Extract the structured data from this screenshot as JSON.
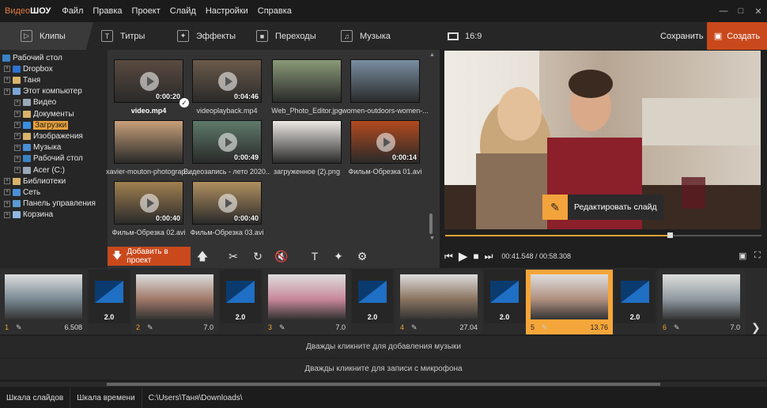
{
  "app": {
    "logo_part1": "Видео",
    "logo_part2": "ШОУ",
    "menu": [
      "Файл",
      "Правка",
      "Проект",
      "Слайд",
      "Настройки",
      "Справка"
    ]
  },
  "tabs": [
    "Клипы",
    "Титры",
    "Эффекты",
    "Переходы",
    "Музыка"
  ],
  "header": {
    "ratio": "16:9",
    "save": "Сохранить",
    "create": "Создать"
  },
  "tree": [
    {
      "label": "Рабочий стол",
      "level": 0
    },
    {
      "label": "Dropbox",
      "level": 1
    },
    {
      "label": "Таня",
      "level": 1
    },
    {
      "label": "Этот компьютер",
      "level": 1
    },
    {
      "label": "Видео",
      "level": 2
    },
    {
      "label": "Документы",
      "level": 2
    },
    {
      "label": "Загрузки",
      "level": 2,
      "selected": true
    },
    {
      "label": "Изображения",
      "level": 2
    },
    {
      "label": "Музыка",
      "level": 2
    },
    {
      "label": "Рабочий стол",
      "level": 2
    },
    {
      "label": "Acer (C:)",
      "level": 2
    },
    {
      "label": "Библиотеки",
      "level": 1
    },
    {
      "label": "Сеть",
      "level": 1
    },
    {
      "label": "Панель управления",
      "level": 1
    },
    {
      "label": "Корзина",
      "level": 1
    }
  ],
  "files": [
    {
      "name": "video.mp4",
      "duration": "0:00:20",
      "checked": true,
      "bold": true
    },
    {
      "name": "videoplayback.mp4",
      "duration": "0:04:46"
    },
    {
      "name": "Web_Photo_Editor.jpg",
      "duration": ""
    },
    {
      "name": "women-outdoors-women-...",
      "duration": ""
    },
    {
      "name": "xavier-mouton-photograp...",
      "duration": ""
    },
    {
      "name": "Видеозапись - лето 2020...",
      "duration": "0:00:49"
    },
    {
      "name": "загруженное (2).png",
      "duration": ""
    },
    {
      "name": "Фильм-Обрезка 01.avi",
      "duration": "0:00:14"
    },
    {
      "name": "Фильм-Обрезка 02.avi",
      "duration": "0:00:40"
    },
    {
      "name": "Фильм-Обрезка 03.avi",
      "duration": "0:00:40"
    }
  ],
  "preview": {
    "edit_slide": "Редактировать слайд",
    "progress": 0.71
  },
  "toolbar": {
    "add": "Добавить в проект"
  },
  "player": {
    "time": "00:41.548 / 00:58.308"
  },
  "slides": [
    {
      "num": "1",
      "dur": "6.508"
    },
    {
      "num": "2",
      "dur": "7.0"
    },
    {
      "num": "3",
      "dur": "7.0"
    },
    {
      "num": "4",
      "dur": "27.04"
    },
    {
      "num": "5",
      "dur": "13.76",
      "active": true
    },
    {
      "num": "6",
      "dur": "7.0"
    }
  ],
  "transitions": [
    "2.0",
    "2.0",
    "2.0",
    "2.0",
    "2.0"
  ],
  "tracks": {
    "music": "Дважды кликните для добавления музыки",
    "mic": "Дважды кликните для записи с микрофона"
  },
  "status": {
    "slides": "Шкала слайдов",
    "timeline": "Шкала времени",
    "path": "C:\\Users\\Таня\\Downloads\\"
  }
}
